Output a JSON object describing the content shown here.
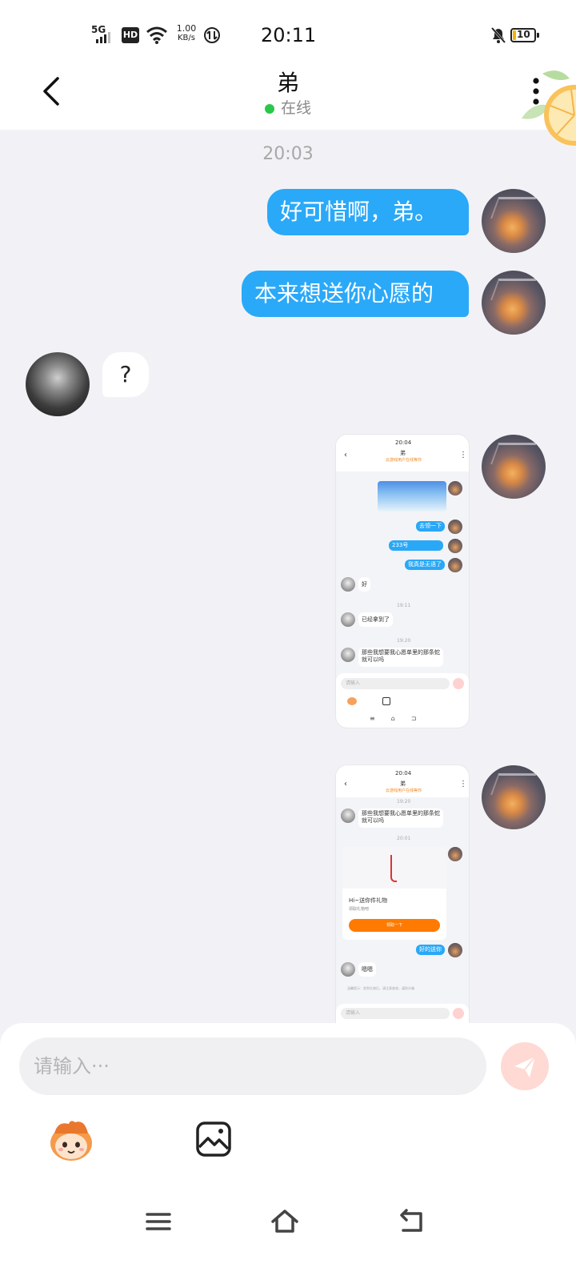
{
  "status": {
    "network": "5G",
    "hd": "HD",
    "speed_value": "1.00",
    "speed_unit": "KB/s",
    "time": "20:11",
    "battery": "10"
  },
  "header": {
    "title": "弟",
    "status": "在线"
  },
  "chat": {
    "timestamp": "20:03",
    "messages": [
      {
        "from": "me",
        "text": "好可惜啊，弟。"
      },
      {
        "from": "me",
        "text": "本来想送你心愿的"
      },
      {
        "from": "friend",
        "text": "?"
      }
    ],
    "shot1": {
      "status_time": "20:04",
      "title": "弟",
      "subtitle": "云游戏用户在线等你",
      "out1": "去领一下",
      "out2": "233号",
      "out3": "我真是无语了",
      "in1": "好",
      "ts1": "19:11",
      "in2": "已经拿到了",
      "ts2": "19:20",
      "in3_line1": "那些我想要我心愿单里的那条蛇",
      "in3_line2": "就可以吗",
      "input": "请输入"
    },
    "shot2": {
      "status_time": "20:04",
      "title": "弟",
      "subtitle": "云游戏用户在线等你",
      "ts1": "19:20",
      "in1_line1": "那些我想要我心愿单里的那条蛇",
      "in1_line2": "就可以吗",
      "ts2": "20:01",
      "card_title": "Hi~送你件礼物",
      "card_sub": "领取礼物吧",
      "card_button": "领取一下",
      "out1": "好的送你",
      "in2": "嗯嗯",
      "notice": "温馨提示：收到礼物后，请注意查收，谨防诈骗",
      "input": "请输入"
    }
  },
  "composer": {
    "placeholder": "请输入···"
  },
  "colors": {
    "accent": "#2aa9f8",
    "online": "#2ac84a",
    "send_disabled": "#ffd9d3"
  }
}
